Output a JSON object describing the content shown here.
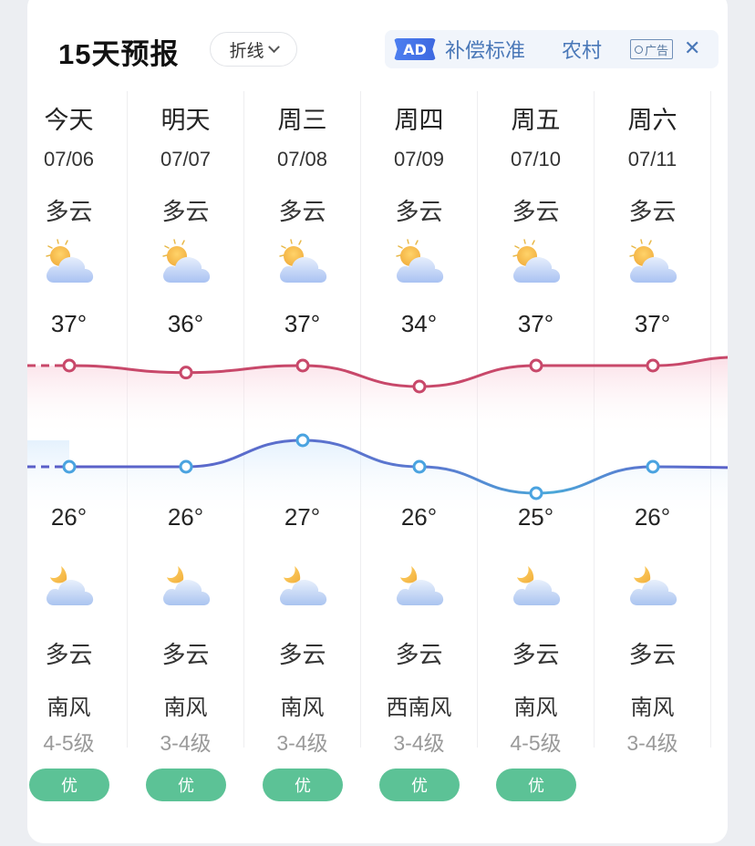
{
  "header": {
    "title": "15天预报",
    "mode_label": "折线",
    "ad": {
      "badge": "AD",
      "text_1": "补偿标准",
      "text_2": "农村",
      "tag": "广告",
      "close": "✕"
    }
  },
  "days": [
    {
      "day": "今天",
      "date": "07/06",
      "day_cond": "多云",
      "high": "37°",
      "low": "26°",
      "night_cond": "多云",
      "wind": "南风",
      "level": "4-5级",
      "aqi": "优"
    },
    {
      "day": "明天",
      "date": "07/07",
      "day_cond": "多云",
      "high": "36°",
      "low": "26°",
      "night_cond": "多云",
      "wind": "南风",
      "level": "3-4级",
      "aqi": "优"
    },
    {
      "day": "周三",
      "date": "07/08",
      "day_cond": "多云",
      "high": "37°",
      "low": "27°",
      "night_cond": "多云",
      "wind": "南风",
      "level": "3-4级",
      "aqi": "优"
    },
    {
      "day": "周四",
      "date": "07/09",
      "day_cond": "多云",
      "high": "34°",
      "low": "26°",
      "night_cond": "多云",
      "wind": "西南风",
      "level": "3-4级",
      "aqi": "优"
    },
    {
      "day": "周五",
      "date": "07/10",
      "day_cond": "多云",
      "high": "37°",
      "low": "25°",
      "night_cond": "多云",
      "wind": "南风",
      "level": "4-5级",
      "aqi": "优"
    },
    {
      "day": "周六",
      "date": "07/11",
      "day_cond": "多云",
      "high": "37°",
      "low": "26°",
      "night_cond": "多云",
      "wind": "南风",
      "level": "3-4级",
      "aqi": ""
    }
  ],
  "chart_data": {
    "type": "line",
    "categories": [
      "07/06",
      "07/07",
      "07/08",
      "07/09",
      "07/10",
      "07/11"
    ],
    "series": [
      {
        "name": "high",
        "values": [
          37,
          36,
          37,
          34,
          37,
          37
        ],
        "color": "#c8486a"
      },
      {
        "name": "low",
        "values": [
          26,
          26,
          27,
          26,
          25,
          26
        ],
        "color": "#5a5fc8"
      }
    ]
  },
  "colors": {
    "aqi_good": "#5cc296",
    "high_line": "#c8486a",
    "low_line": "#5a5fc8",
    "low_marker": "#4aa3e0",
    "ad_text": "#4a78b8"
  },
  "icons": {
    "day": "partly-cloudy-day-icon",
    "night": "partly-cloudy-night-icon"
  }
}
